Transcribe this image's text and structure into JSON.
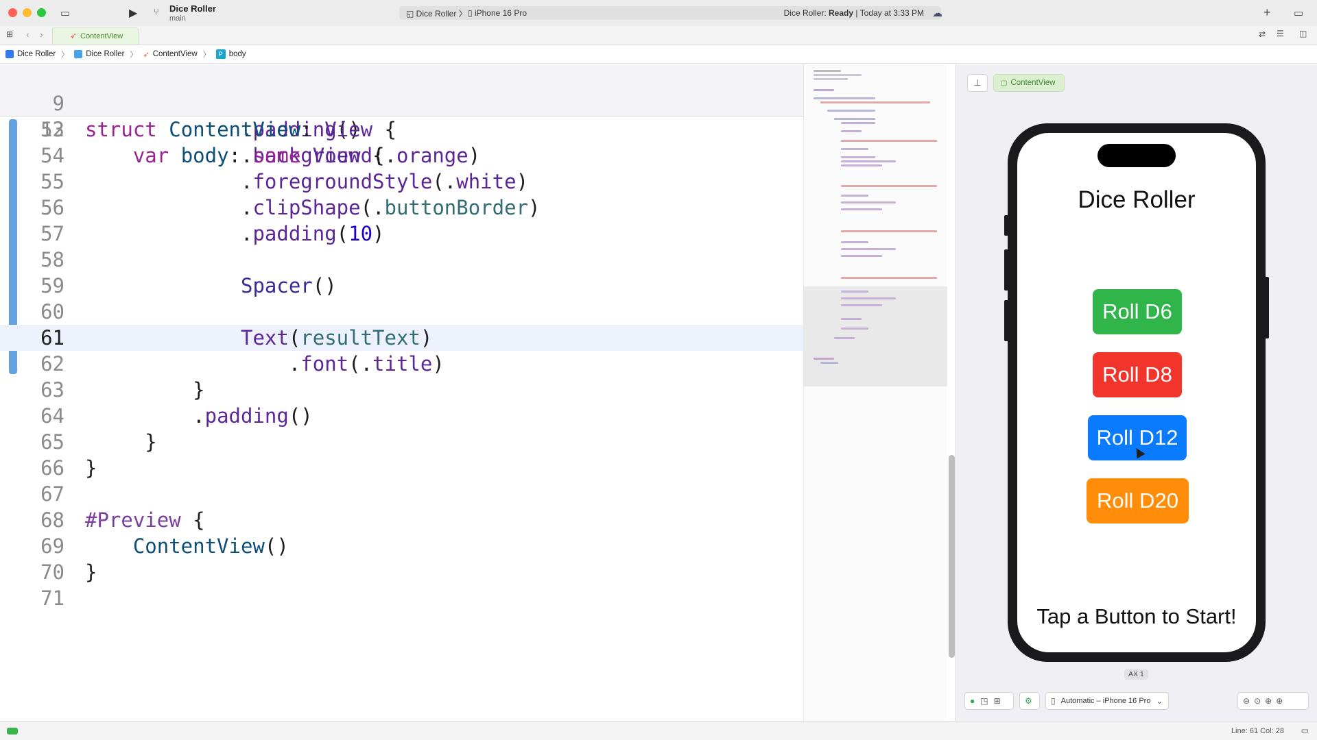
{
  "toolbar": {
    "project_name": "Dice Roller",
    "branch": "main",
    "scheme": "Dice Roller",
    "device": "iPhone 16 Pro",
    "status_prefix": "Dice Roller:",
    "status_state": "Ready",
    "status_time": "| Today at 3:33 PM"
  },
  "tab": {
    "label": "ContentView"
  },
  "breadcrumb": [
    "Dice Roller",
    "Dice Roller",
    "ContentView",
    "body"
  ],
  "editor": {
    "sticky": [
      {
        "num": "9"
      },
      {
        "num": "12"
      }
    ],
    "line_numbers": [
      "53",
      "54",
      "55",
      "56",
      "57",
      "58",
      "59",
      "60",
      "61",
      "62",
      "63",
      "64",
      "65",
      "66",
      "67",
      "68",
      "69",
      "70",
      "71"
    ],
    "current_line": "61"
  },
  "preview": {
    "tab_label": "ContentView",
    "app_title": "Dice Roller",
    "buttons": [
      {
        "label": "Roll D6",
        "color": "#2fb54a"
      },
      {
        "label": "Roll D8",
        "color": "#f2352c"
      },
      {
        "label": "Roll D12",
        "color": "#0a7aff"
      },
      {
        "label": "Roll D20",
        "color": "#ff8d0a"
      }
    ],
    "result_text": "Tap a Button to Start!",
    "ax_label": "AX 1",
    "device_selector": "Automatic – iPhone 16 Pro"
  },
  "statusbar": {
    "cursor": "Line: 61  Col: 28"
  }
}
